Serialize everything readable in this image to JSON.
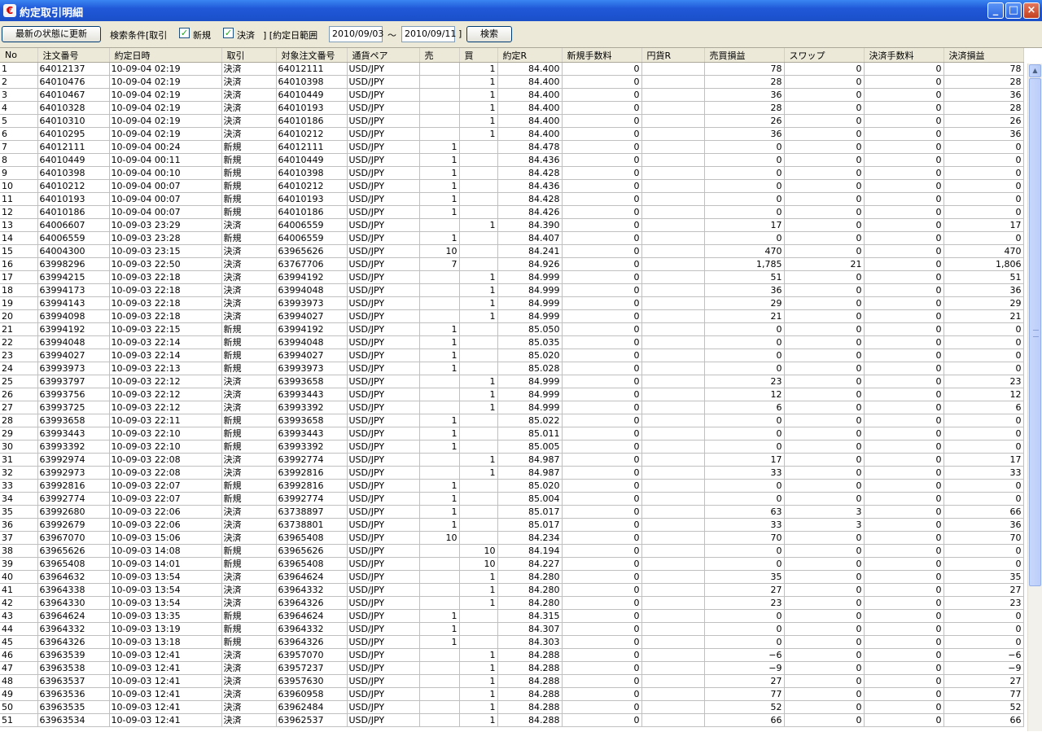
{
  "window": {
    "title": "約定取引明細",
    "icon": "app-icon",
    "icon_glyph": "€"
  },
  "window_buttons": {
    "minimize": "_",
    "maximize": "□",
    "close": "×"
  },
  "toolbar": {
    "refresh_label": "最新の状態に更新",
    "condition_label": "検索条件[取引",
    "new_label": "新規",
    "settle_label": "決済",
    "range_label": "] [約定日範囲",
    "date_from": "2010/09/03",
    "tilde": "～",
    "date_to": "2010/09/11",
    "range_close": "]",
    "search_label": "検索",
    "new_checked": true,
    "settle_checked": true
  },
  "columns": [
    "No",
    "注文番号",
    "約定日時",
    "取引",
    "対象注文番号",
    "通貨ペア",
    "売",
    "買",
    "約定R",
    "新規手数料",
    "円貨R",
    "売買損益",
    "スワップ",
    "決済手数料",
    "決済損益"
  ],
  "rows": [
    [
      "1",
      "64012137",
      "10-09-04 02:19",
      "決済",
      "64012111",
      "USD/JPY",
      "",
      "1",
      "84.400",
      "0",
      "",
      "78",
      "0",
      "0",
      "78"
    ],
    [
      "2",
      "64010476",
      "10-09-04 02:19",
      "決済",
      "64010398",
      "USD/JPY",
      "",
      "1",
      "84.400",
      "0",
      "",
      "28",
      "0",
      "0",
      "28"
    ],
    [
      "3",
      "64010467",
      "10-09-04 02:19",
      "決済",
      "64010449",
      "USD/JPY",
      "",
      "1",
      "84.400",
      "0",
      "",
      "36",
      "0",
      "0",
      "36"
    ],
    [
      "4",
      "64010328",
      "10-09-04 02:19",
      "決済",
      "64010193",
      "USD/JPY",
      "",
      "1",
      "84.400",
      "0",
      "",
      "28",
      "0",
      "0",
      "28"
    ],
    [
      "5",
      "64010310",
      "10-09-04 02:19",
      "決済",
      "64010186",
      "USD/JPY",
      "",
      "1",
      "84.400",
      "0",
      "",
      "26",
      "0",
      "0",
      "26"
    ],
    [
      "6",
      "64010295",
      "10-09-04 02:19",
      "決済",
      "64010212",
      "USD/JPY",
      "",
      "1",
      "84.400",
      "0",
      "",
      "36",
      "0",
      "0",
      "36"
    ],
    [
      "7",
      "64012111",
      "10-09-04 00:24",
      "新規",
      "64012111",
      "USD/JPY",
      "1",
      "",
      "84.478",
      "0",
      "",
      "0",
      "0",
      "0",
      "0"
    ],
    [
      "8",
      "64010449",
      "10-09-04 00:11",
      "新規",
      "64010449",
      "USD/JPY",
      "1",
      "",
      "84.436",
      "0",
      "",
      "0",
      "0",
      "0",
      "0"
    ],
    [
      "9",
      "64010398",
      "10-09-04 00:10",
      "新規",
      "64010398",
      "USD/JPY",
      "1",
      "",
      "84.428",
      "0",
      "",
      "0",
      "0",
      "0",
      "0"
    ],
    [
      "10",
      "64010212",
      "10-09-04 00:07",
      "新規",
      "64010212",
      "USD/JPY",
      "1",
      "",
      "84.436",
      "0",
      "",
      "0",
      "0",
      "0",
      "0"
    ],
    [
      "11",
      "64010193",
      "10-09-04 00:07",
      "新規",
      "64010193",
      "USD/JPY",
      "1",
      "",
      "84.428",
      "0",
      "",
      "0",
      "0",
      "0",
      "0"
    ],
    [
      "12",
      "64010186",
      "10-09-04 00:07",
      "新規",
      "64010186",
      "USD/JPY",
      "1",
      "",
      "84.426",
      "0",
      "",
      "0",
      "0",
      "0",
      "0"
    ],
    [
      "13",
      "64006607",
      "10-09-03 23:29",
      "決済",
      "64006559",
      "USD/JPY",
      "",
      "1",
      "84.390",
      "0",
      "",
      "17",
      "0",
      "0",
      "17"
    ],
    [
      "14",
      "64006559",
      "10-09-03 23:28",
      "新規",
      "64006559",
      "USD/JPY",
      "1",
      "",
      "84.407",
      "0",
      "",
      "0",
      "0",
      "0",
      "0"
    ],
    [
      "15",
      "64004300",
      "10-09-03 23:15",
      "決済",
      "63965626",
      "USD/JPY",
      "10",
      "",
      "84.241",
      "0",
      "",
      "470",
      "0",
      "0",
      "470"
    ],
    [
      "16",
      "63998296",
      "10-09-03 22:50",
      "決済",
      "63767706",
      "USD/JPY",
      "7",
      "",
      "84.926",
      "0",
      "",
      "1,785",
      "21",
      "0",
      "1,806"
    ],
    [
      "17",
      "63994215",
      "10-09-03 22:18",
      "決済",
      "63994192",
      "USD/JPY",
      "",
      "1",
      "84.999",
      "0",
      "",
      "51",
      "0",
      "0",
      "51"
    ],
    [
      "18",
      "63994173",
      "10-09-03 22:18",
      "決済",
      "63994048",
      "USD/JPY",
      "",
      "1",
      "84.999",
      "0",
      "",
      "36",
      "0",
      "0",
      "36"
    ],
    [
      "19",
      "63994143",
      "10-09-03 22:18",
      "決済",
      "63993973",
      "USD/JPY",
      "",
      "1",
      "84.999",
      "0",
      "",
      "29",
      "0",
      "0",
      "29"
    ],
    [
      "20",
      "63994098",
      "10-09-03 22:18",
      "決済",
      "63994027",
      "USD/JPY",
      "",
      "1",
      "84.999",
      "0",
      "",
      "21",
      "0",
      "0",
      "21"
    ],
    [
      "21",
      "63994192",
      "10-09-03 22:15",
      "新規",
      "63994192",
      "USD/JPY",
      "1",
      "",
      "85.050",
      "0",
      "",
      "0",
      "0",
      "0",
      "0"
    ],
    [
      "22",
      "63994048",
      "10-09-03 22:14",
      "新規",
      "63994048",
      "USD/JPY",
      "1",
      "",
      "85.035",
      "0",
      "",
      "0",
      "0",
      "0",
      "0"
    ],
    [
      "23",
      "63994027",
      "10-09-03 22:14",
      "新規",
      "63994027",
      "USD/JPY",
      "1",
      "",
      "85.020",
      "0",
      "",
      "0",
      "0",
      "0",
      "0"
    ],
    [
      "24",
      "63993973",
      "10-09-03 22:13",
      "新規",
      "63993973",
      "USD/JPY",
      "1",
      "",
      "85.028",
      "0",
      "",
      "0",
      "0",
      "0",
      "0"
    ],
    [
      "25",
      "63993797",
      "10-09-03 22:12",
      "決済",
      "63993658",
      "USD/JPY",
      "",
      "1",
      "84.999",
      "0",
      "",
      "23",
      "0",
      "0",
      "23"
    ],
    [
      "26",
      "63993756",
      "10-09-03 22:12",
      "決済",
      "63993443",
      "USD/JPY",
      "",
      "1",
      "84.999",
      "0",
      "",
      "12",
      "0",
      "0",
      "12"
    ],
    [
      "27",
      "63993725",
      "10-09-03 22:12",
      "決済",
      "63993392",
      "USD/JPY",
      "",
      "1",
      "84.999",
      "0",
      "",
      "6",
      "0",
      "0",
      "6"
    ],
    [
      "28",
      "63993658",
      "10-09-03 22:11",
      "新規",
      "63993658",
      "USD/JPY",
      "1",
      "",
      "85.022",
      "0",
      "",
      "0",
      "0",
      "0",
      "0"
    ],
    [
      "29",
      "63993443",
      "10-09-03 22:10",
      "新規",
      "63993443",
      "USD/JPY",
      "1",
      "",
      "85.011",
      "0",
      "",
      "0",
      "0",
      "0",
      "0"
    ],
    [
      "30",
      "63993392",
      "10-09-03 22:10",
      "新規",
      "63993392",
      "USD/JPY",
      "1",
      "",
      "85.005",
      "0",
      "",
      "0",
      "0",
      "0",
      "0"
    ],
    [
      "31",
      "63992974",
      "10-09-03 22:08",
      "決済",
      "63992774",
      "USD/JPY",
      "",
      "1",
      "84.987",
      "0",
      "",
      "17",
      "0",
      "0",
      "17"
    ],
    [
      "32",
      "63992973",
      "10-09-03 22:08",
      "決済",
      "63992816",
      "USD/JPY",
      "",
      "1",
      "84.987",
      "0",
      "",
      "33",
      "0",
      "0",
      "33"
    ],
    [
      "33",
      "63992816",
      "10-09-03 22:07",
      "新規",
      "63992816",
      "USD/JPY",
      "1",
      "",
      "85.020",
      "0",
      "",
      "0",
      "0",
      "0",
      "0"
    ],
    [
      "34",
      "63992774",
      "10-09-03 22:07",
      "新規",
      "63992774",
      "USD/JPY",
      "1",
      "",
      "85.004",
      "0",
      "",
      "0",
      "0",
      "0",
      "0"
    ],
    [
      "35",
      "63992680",
      "10-09-03 22:06",
      "決済",
      "63738897",
      "USD/JPY",
      "1",
      "",
      "85.017",
      "0",
      "",
      "63",
      "3",
      "0",
      "66"
    ],
    [
      "36",
      "63992679",
      "10-09-03 22:06",
      "決済",
      "63738801",
      "USD/JPY",
      "1",
      "",
      "85.017",
      "0",
      "",
      "33",
      "3",
      "0",
      "36"
    ],
    [
      "37",
      "63967070",
      "10-09-03 15:06",
      "決済",
      "63965408",
      "USD/JPY",
      "10",
      "",
      "84.234",
      "0",
      "",
      "70",
      "0",
      "0",
      "70"
    ],
    [
      "38",
      "63965626",
      "10-09-03 14:08",
      "新規",
      "63965626",
      "USD/JPY",
      "",
      "10",
      "84.194",
      "0",
      "",
      "0",
      "0",
      "0",
      "0"
    ],
    [
      "39",
      "63965408",
      "10-09-03 14:01",
      "新規",
      "63965408",
      "USD/JPY",
      "",
      "10",
      "84.227",
      "0",
      "",
      "0",
      "0",
      "0",
      "0"
    ],
    [
      "40",
      "63964632",
      "10-09-03 13:54",
      "決済",
      "63964624",
      "USD/JPY",
      "",
      "1",
      "84.280",
      "0",
      "",
      "35",
      "0",
      "0",
      "35"
    ],
    [
      "41",
      "63964338",
      "10-09-03 13:54",
      "決済",
      "63964332",
      "USD/JPY",
      "",
      "1",
      "84.280",
      "0",
      "",
      "27",
      "0",
      "0",
      "27"
    ],
    [
      "42",
      "63964330",
      "10-09-03 13:54",
      "決済",
      "63964326",
      "USD/JPY",
      "",
      "1",
      "84.280",
      "0",
      "",
      "23",
      "0",
      "0",
      "23"
    ],
    [
      "43",
      "63964624",
      "10-09-03 13:35",
      "新規",
      "63964624",
      "USD/JPY",
      "1",
      "",
      "84.315",
      "0",
      "",
      "0",
      "0",
      "0",
      "0"
    ],
    [
      "44",
      "63964332",
      "10-09-03 13:19",
      "新規",
      "63964332",
      "USD/JPY",
      "1",
      "",
      "84.307",
      "0",
      "",
      "0",
      "0",
      "0",
      "0"
    ],
    [
      "45",
      "63964326",
      "10-09-03 13:18",
      "新規",
      "63964326",
      "USD/JPY",
      "1",
      "",
      "84.303",
      "0",
      "",
      "0",
      "0",
      "0",
      "0"
    ],
    [
      "46",
      "63963539",
      "10-09-03 12:41",
      "決済",
      "63957070",
      "USD/JPY",
      "",
      "1",
      "84.288",
      "0",
      "",
      "−6",
      "0",
      "0",
      "−6"
    ],
    [
      "47",
      "63963538",
      "10-09-03 12:41",
      "決済",
      "63957237",
      "USD/JPY",
      "",
      "1",
      "84.288",
      "0",
      "",
      "−9",
      "0",
      "0",
      "−9"
    ],
    [
      "48",
      "63963537",
      "10-09-03 12:41",
      "決済",
      "63957630",
      "USD/JPY",
      "",
      "1",
      "84.288",
      "0",
      "",
      "27",
      "0",
      "0",
      "27"
    ],
    [
      "49",
      "63963536",
      "10-09-03 12:41",
      "決済",
      "63960958",
      "USD/JPY",
      "",
      "1",
      "84.288",
      "0",
      "",
      "77",
      "0",
      "0",
      "77"
    ],
    [
      "50",
      "63963535",
      "10-09-03 12:41",
      "決済",
      "63962484",
      "USD/JPY",
      "",
      "1",
      "84.288",
      "0",
      "",
      "52",
      "0",
      "0",
      "52"
    ],
    [
      "51",
      "63963534",
      "10-09-03 12:41",
      "決済",
      "63962537",
      "USD/JPY",
      "",
      "1",
      "84.288",
      "0",
      "",
      "66",
      "0",
      "0",
      "66"
    ]
  ],
  "scrollbar": {
    "up": "▲",
    "down": "▼"
  }
}
